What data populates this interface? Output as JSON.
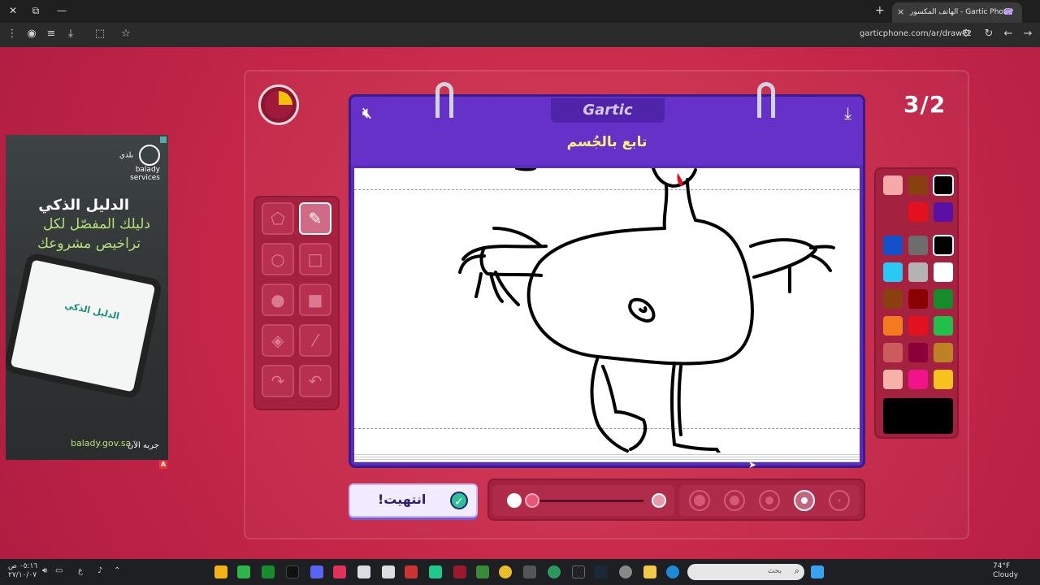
{
  "browser": {
    "tab_title": "الهاتف المكسور - Gartic Phone",
    "url": "garticphone.com/ar/draw?2",
    "new_tab_icon": "+",
    "close_tab_icon": "×"
  },
  "ad": {
    "brand": "بلدي",
    "brand_latin": "balady",
    "brand_sub": "services",
    "headline": "الدليل الذكي",
    "line1": "دليلك المفصّل لكل",
    "line2": "تراخيص مشروعك",
    "tablet_text": "الدليل الذكي",
    "cta": "جربه الآن",
    "site": "balady.gov.sa"
  },
  "game": {
    "round_counter": "3/2",
    "logo": "Gartic",
    "prompt": "تابع بالجُسم",
    "done_label": "انتهيت!",
    "timer_fraction_elapsed": 0.25,
    "accent_color": "#6531c9",
    "prompt_color": "#f8f37a"
  },
  "palette": [
    "#f7a9a8",
    "#8a3f10",
    "#000000",
    "",
    "#e3101e",
    "#5a0fa8",
    "#1251c9",
    "#6d6d6d",
    "#000000",
    "#29c8f5",
    "#b3b3b3",
    "#ffffff",
    "#8a3f10",
    "#8b0000",
    "#178a2c",
    "#f47a20",
    "#e3101e",
    "#22c04a",
    "#cc5c5c",
    "#8b0038",
    "#c08026",
    "#f7b2a8",
    "#f0138a",
    "#f7c21f"
  ],
  "selected_color": "#000000",
  "brush": {
    "opacity_percent": 100,
    "sizes": [
      "size-1",
      "size-2",
      "size-3",
      "size-4",
      "size-5"
    ],
    "selected_size_index": 3
  },
  "taskbar": {
    "search_placeholder": "بحث",
    "weather_temp": "74°F",
    "weather_desc": "Cloudy",
    "clock_time": "٠٥:١٦ ص",
    "clock_date": "٢٧/١٠/٠٧",
    "lang": "ع"
  }
}
